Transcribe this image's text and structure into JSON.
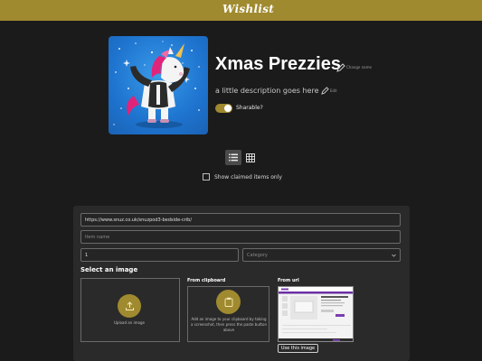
{
  "header": {
    "logo_text": "Wishlist"
  },
  "list": {
    "title": "Xmas Prezzies",
    "change_name_label": "Change name",
    "description": "a little description goes here",
    "edit_label": "Edit",
    "sharable_label": "Sharable?",
    "sharable_on": true
  },
  "view": {
    "active": "list"
  },
  "filter": {
    "claimed_only_label": "Show claimed items only",
    "claimed_only_checked": false
  },
  "form": {
    "url_value": "https://www.snuz.co.uk/snuzpod3-bedside-crib/",
    "name_placeholder": "Item name",
    "quantity_value": "1",
    "category_placeholder": "Category",
    "select_image_title": "Select an image",
    "upload_label": "Upload an image",
    "clipboard_title": "From clipboard",
    "clipboard_text": "Add an image to your clipboard by taking a screenshot, then press the paste button above",
    "url_title": "From url",
    "use_image_label": "Use this image"
  },
  "colors": {
    "accent": "#a08a2f",
    "background": "#1b1b1b",
    "panel": "#2a2a2a"
  }
}
